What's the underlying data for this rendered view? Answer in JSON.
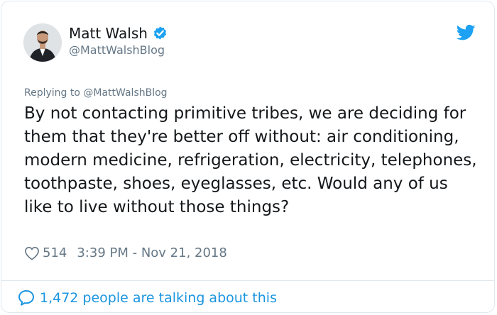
{
  "author": {
    "name": "Matt Walsh",
    "handle": "@MattWalshBlog",
    "verified": true
  },
  "reply": {
    "prefix": "Replying to",
    "handle": "@MattWalshBlog"
  },
  "tweet": {
    "text": "By not contacting primitive tribes, we are deciding for them that they're better off without: air conditioning, modern medicine, refrigeration, electricity, telephones, toothpaste, shoes, eyeglasses, etc. Would any of us like to live without those things?"
  },
  "meta": {
    "likes": "514",
    "timestamp": "3:39 PM - Nov 21, 2018"
  },
  "footer": {
    "talking": "1,472 people are talking about this"
  },
  "colors": {
    "twitter_blue": "#1da1f2",
    "link_blue": "#1b95e0",
    "secondary_text": "#657786"
  },
  "icons": [
    "verified-badge-icon",
    "twitter-bird-icon",
    "heart-icon",
    "speech-bubble-icon"
  ]
}
